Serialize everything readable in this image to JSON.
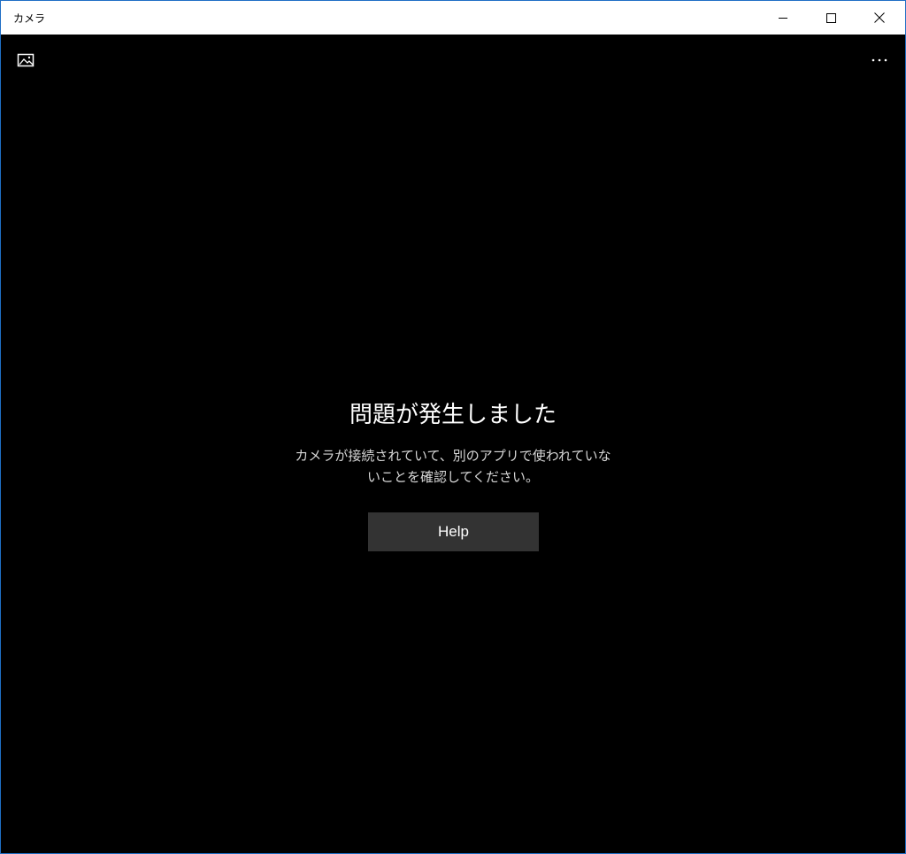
{
  "window": {
    "title": "カメラ"
  },
  "toolbar": {
    "gallery_icon": "photo-gallery-icon",
    "more_icon": "more-options-icon"
  },
  "error": {
    "title": "問題が発生しました",
    "message": "カメラが接続されていて、別のアプリで使われていないことを確認してください。"
  },
  "help_button": {
    "label": "Help"
  },
  "colors": {
    "background": "#000000",
    "button": "#333333",
    "border": "#1f6fc5"
  }
}
